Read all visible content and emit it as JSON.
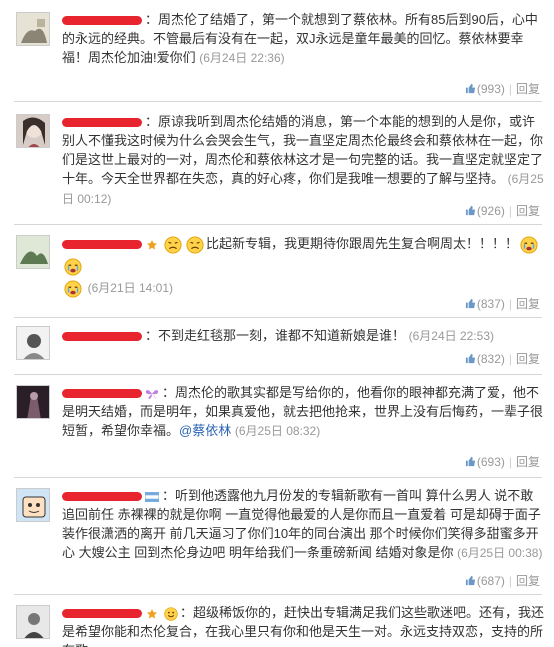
{
  "comments": [
    {
      "text": "：周杰伦了结婚了，第一个就想到了蔡依林。所有85后到90后，心中的永远的经典。不管最后有没有在一起，双J永远是童年最美的回忆。蔡依林要幸福！周杰伦加油!爱你们",
      "time": "(6月24日 22:36)",
      "likes": "(993)",
      "reply_label": "回复"
    },
    {
      "text": "：原谅我听到周杰伦结婚的消息，第一个本能的想到的人是你，或许别人不懂我这时候为什么会哭会生气，我一直坚定周杰伦最终会和蔡依林在一起，你们是这世上最对的一对，周杰伦和蔡依林这才是一句完整的话。我一直坚定就坚定了十年。今天全世界都在失恋，真的好心疼，你们是我唯一想要的了解与坚持。",
      "time": "(6月25日 00:12)",
      "likes": "(926)",
      "reply_label": "回复"
    },
    {
      "text": "比起新专辑，我更期待你跟周先生复合啊周太！！！！",
      "time": "(6月21日 14:01)",
      "likes": "(837)",
      "reply_label": "回复"
    },
    {
      "text": "：不到走红毯那一刻，谁都不知道新娘是谁！",
      "time": "(6月24日 22:53)",
      "likes": "(832)",
      "reply_label": "回复"
    },
    {
      "text": "：周杰伦的歌其实都是写给你的，他看你的眼神都充满了爱，他不是明天结婚，而是明年，如果真爱他，就去把他抢来，世界上没有后悔药，一辈子很短暂，希望你幸福。",
      "mention": "@蔡依林",
      "time": "(6月25日 08:32)",
      "likes": "(693)",
      "reply_label": "回复"
    },
    {
      "text": "：听到他透露他九月份发的专辑新歌有一首叫 算什么男人 说不敢追回前任 赤裸裸的就是你啊 一直觉得他最爱的人是你而且一直爱着 可是却碍于面子 装作很潇洒的离开 前几天逼习了你们10年的同台演出 那个时候你们笑得多甜蜜多开心 大嫂公主 回到杰伦身边吧 明年给我们一条重磅新闻 结婚对象是你",
      "time": "(6月25日 00:38)",
      "likes": "(687)",
      "reply_label": "回复"
    },
    {
      "text": "：超级稀饭你的，赶快出专辑满足我们这些歌迷吧。还有，我还是希望你能和杰伦复合，在我心里只有你和他是天生一对。永远支持双恋，支持的所有歌",
      "time": "",
      "likes": "",
      "reply_label": ""
    }
  ]
}
